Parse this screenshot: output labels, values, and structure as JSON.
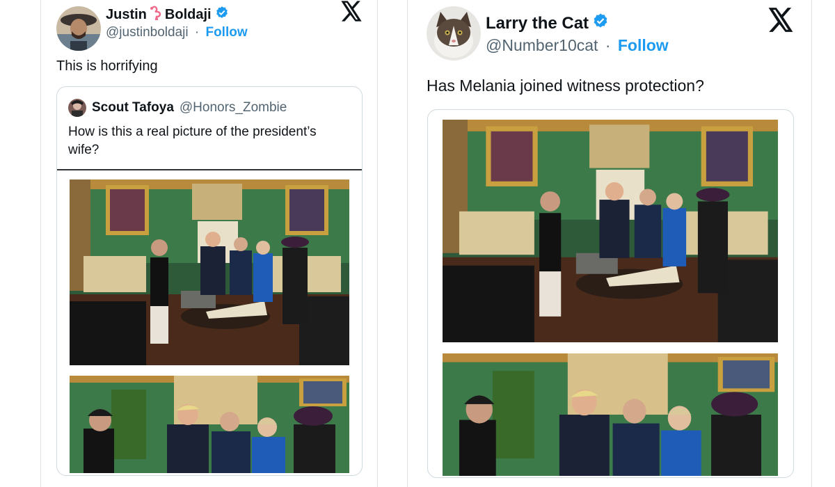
{
  "left_tweet": {
    "author_name": "Justin",
    "author_name_suffix": "Boldaji",
    "handle": "@justinboldaji",
    "separator": "·",
    "follow_label": "Follow",
    "text": "This is horrifying",
    "quoted": {
      "author_name": "Scout Tafoya",
      "handle": "@Honors_Zombie",
      "text_line1": "How is this a real picture of the president’s",
      "text_line2": "wife?"
    }
  },
  "right_tweet": {
    "author_name": "Larry the Cat",
    "handle": "@Number10cat",
    "separator": "·",
    "follow_label": "Follow",
    "text": "Has Melania joined witness protection?"
  },
  "icons": {
    "verified": "verified-badge-icon",
    "x_logo": "x-logo-icon",
    "flamingo": "flamingo-emoji-icon"
  },
  "colors": {
    "verified_blue": "#1d9bf0",
    "follow_blue": "#1d9bf0",
    "handle_gray": "#536471"
  }
}
